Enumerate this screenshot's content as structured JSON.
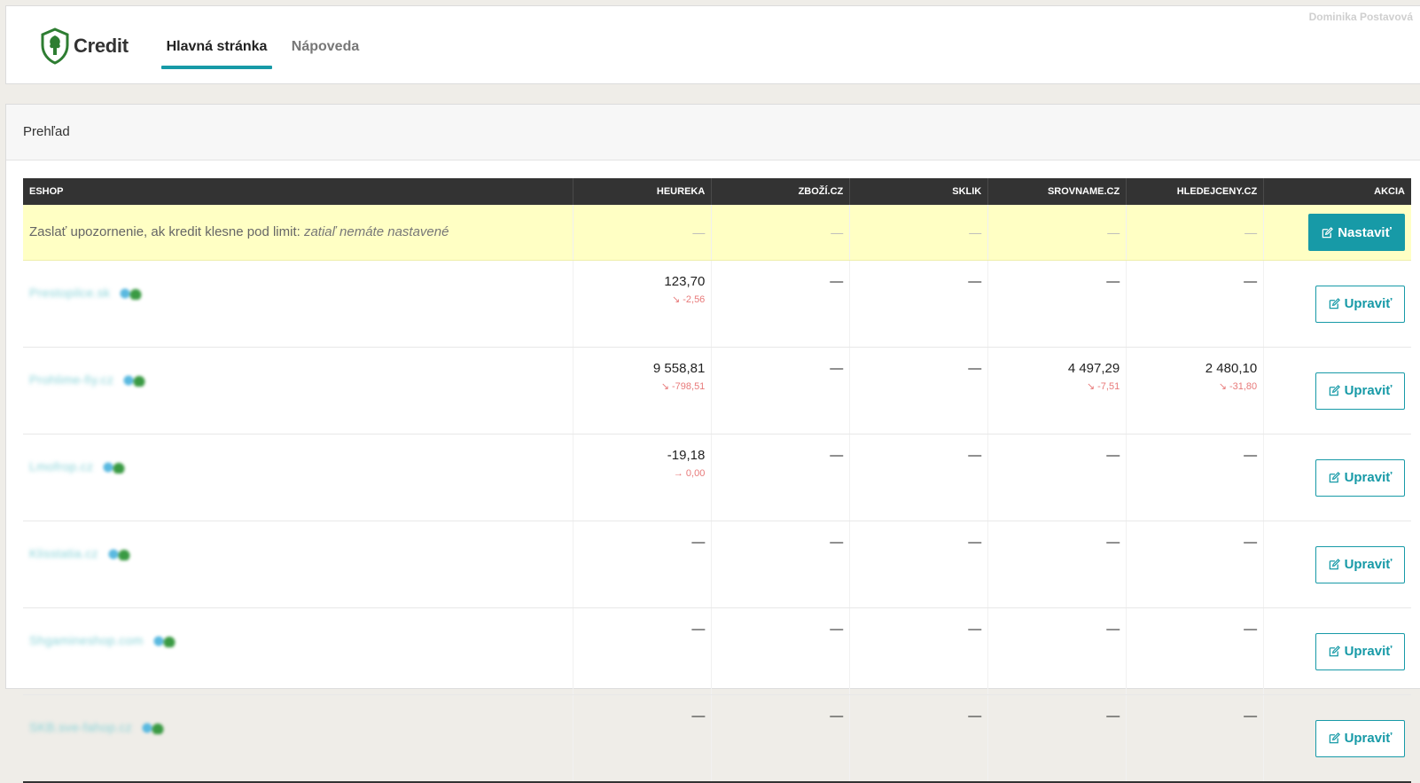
{
  "header": {
    "logo_text": "Credit",
    "tabs": [
      {
        "label": "Hlavná stránka",
        "active": true
      },
      {
        "label": "Nápoveda",
        "active": false
      }
    ],
    "user_name": "Dominika Postavová"
  },
  "panel": {
    "title": "Prehľad"
  },
  "table": {
    "columns": [
      "ESHOP",
      "HEUREKA",
      "ZBOŽÍ.CZ",
      "SKLIK",
      "SROVNAME.CZ",
      "HLEDEJCENY.CZ",
      "AKCIA"
    ],
    "alert": {
      "text": "Zaslať upozornenie, ak kredit klesne pod limit: ",
      "status": "zatiaľ nemáte nastavené",
      "values": [
        "—",
        "—",
        "—",
        "—",
        "—"
      ],
      "button_label": "Nastaviť"
    },
    "rows": [
      {
        "shop": "Prestopilce.sk",
        "cells": [
          {
            "value": "123,70",
            "delta": "↘ -2,56"
          },
          {
            "value": "—"
          },
          {
            "value": "—"
          },
          {
            "value": "—"
          },
          {
            "value": "—"
          }
        ],
        "button_label": "Upraviť"
      },
      {
        "shop": "Prohlime-fiy.cz",
        "cells": [
          {
            "value": "9 558,81",
            "delta": "↘ -798,51"
          },
          {
            "value": "—"
          },
          {
            "value": "—"
          },
          {
            "value": "4 497,29",
            "delta": "↘ -7,51"
          },
          {
            "value": "2 480,10",
            "delta": "↘ -31,80"
          }
        ],
        "button_label": "Upraviť"
      },
      {
        "shop": "Lmofrop.cz",
        "cells": [
          {
            "value": "-19,18",
            "delta": "→ 0,00"
          },
          {
            "value": "—"
          },
          {
            "value": "—"
          },
          {
            "value": "—"
          },
          {
            "value": "—"
          }
        ],
        "button_label": "Upraviť"
      },
      {
        "shop": "Klisstatia.cz",
        "cells": [
          {
            "value": "—"
          },
          {
            "value": "—"
          },
          {
            "value": "—"
          },
          {
            "value": "—"
          },
          {
            "value": "—"
          }
        ],
        "button_label": "Upraviť"
      },
      {
        "shop": "Shgamineshop.com",
        "cells": [
          {
            "value": "—"
          },
          {
            "value": "—"
          },
          {
            "value": "—"
          },
          {
            "value": "—"
          },
          {
            "value": "—"
          }
        ],
        "button_label": "Upraviť"
      },
      {
        "shop": "SKB.sve-fahop.cz",
        "cells": [
          {
            "value": "—"
          },
          {
            "value": "—"
          },
          {
            "value": "—"
          },
          {
            "value": "—"
          },
          {
            "value": "—"
          }
        ],
        "button_label": "Upraviť"
      }
    ]
  },
  "colors": {
    "accent": "#179aa7",
    "alert_bg": "#ffffc4",
    "header_bg": "#333333",
    "negative": "#e87a7a"
  },
  "icons": {
    "logo": "shield-tree-icon",
    "edit": "edit-icon"
  }
}
